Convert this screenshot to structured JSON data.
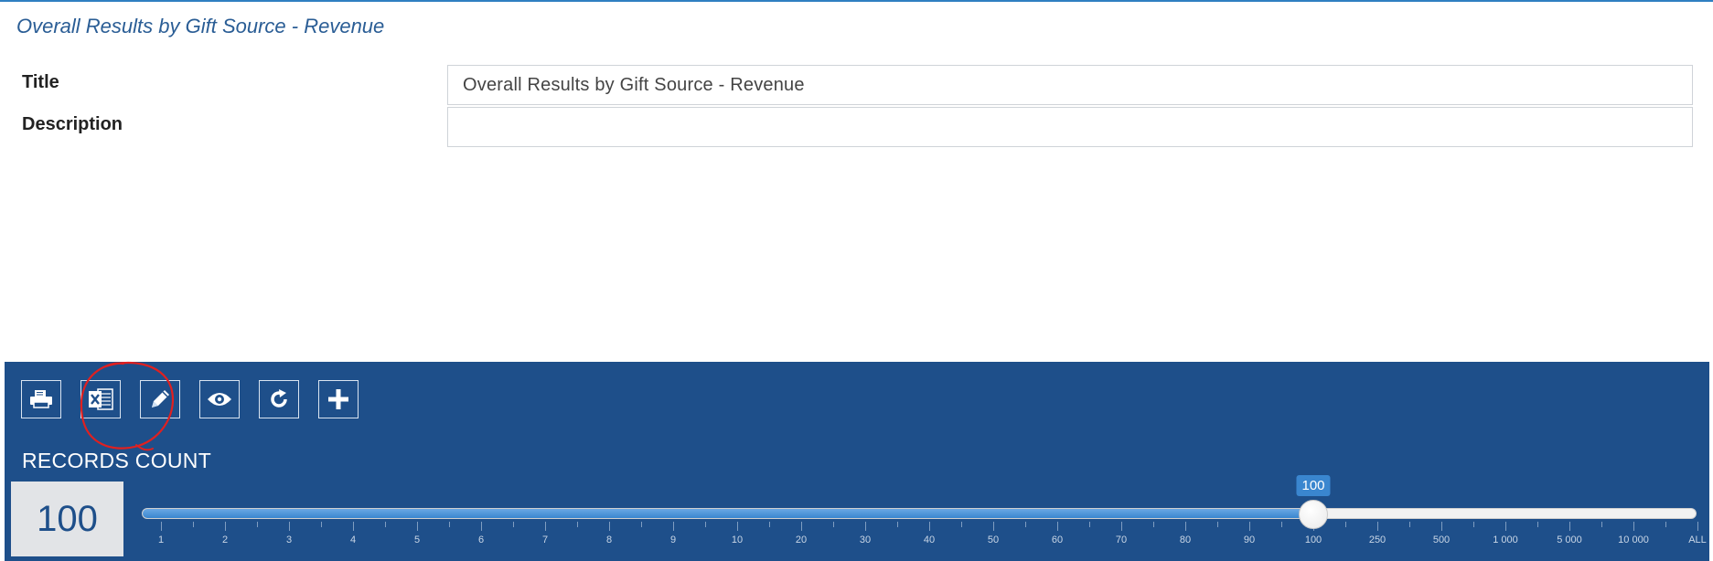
{
  "header": {
    "title": "Overall Results by Gift Source - Revenue"
  },
  "form": {
    "title_label": "Title",
    "title_value": "Overall Results by Gift Source - Revenue",
    "description_label": "Description",
    "description_value": ""
  },
  "toolbar": {
    "buttons": [
      {
        "name": "print-button",
        "icon": "printer-icon"
      },
      {
        "name": "export-excel-button",
        "icon": "excel-icon"
      },
      {
        "name": "edit-button",
        "icon": "pencil-icon"
      },
      {
        "name": "view-button",
        "icon": "eye-icon"
      },
      {
        "name": "refresh-button",
        "icon": "refresh-icon"
      },
      {
        "name": "add-button",
        "icon": "plus-icon"
      }
    ],
    "highlighted_button": "export-excel-button"
  },
  "records": {
    "label": "RECORDS COUNT",
    "value": "100",
    "slider": {
      "tooltip": "100",
      "selected_index": 18,
      "tick_labels": [
        "1",
        "2",
        "3",
        "4",
        "5",
        "6",
        "7",
        "8",
        "9",
        "10",
        "20",
        "30",
        "40",
        "50",
        "60",
        "70",
        "80",
        "90",
        "100",
        "250",
        "500",
        "1 000",
        "5 000",
        "10 000",
        "ALL"
      ]
    }
  },
  "colors": {
    "panel_bg": "#1e4f8a",
    "accent": "#3a86cf",
    "header_text": "#2a5d95",
    "annotation": "#e02020"
  }
}
